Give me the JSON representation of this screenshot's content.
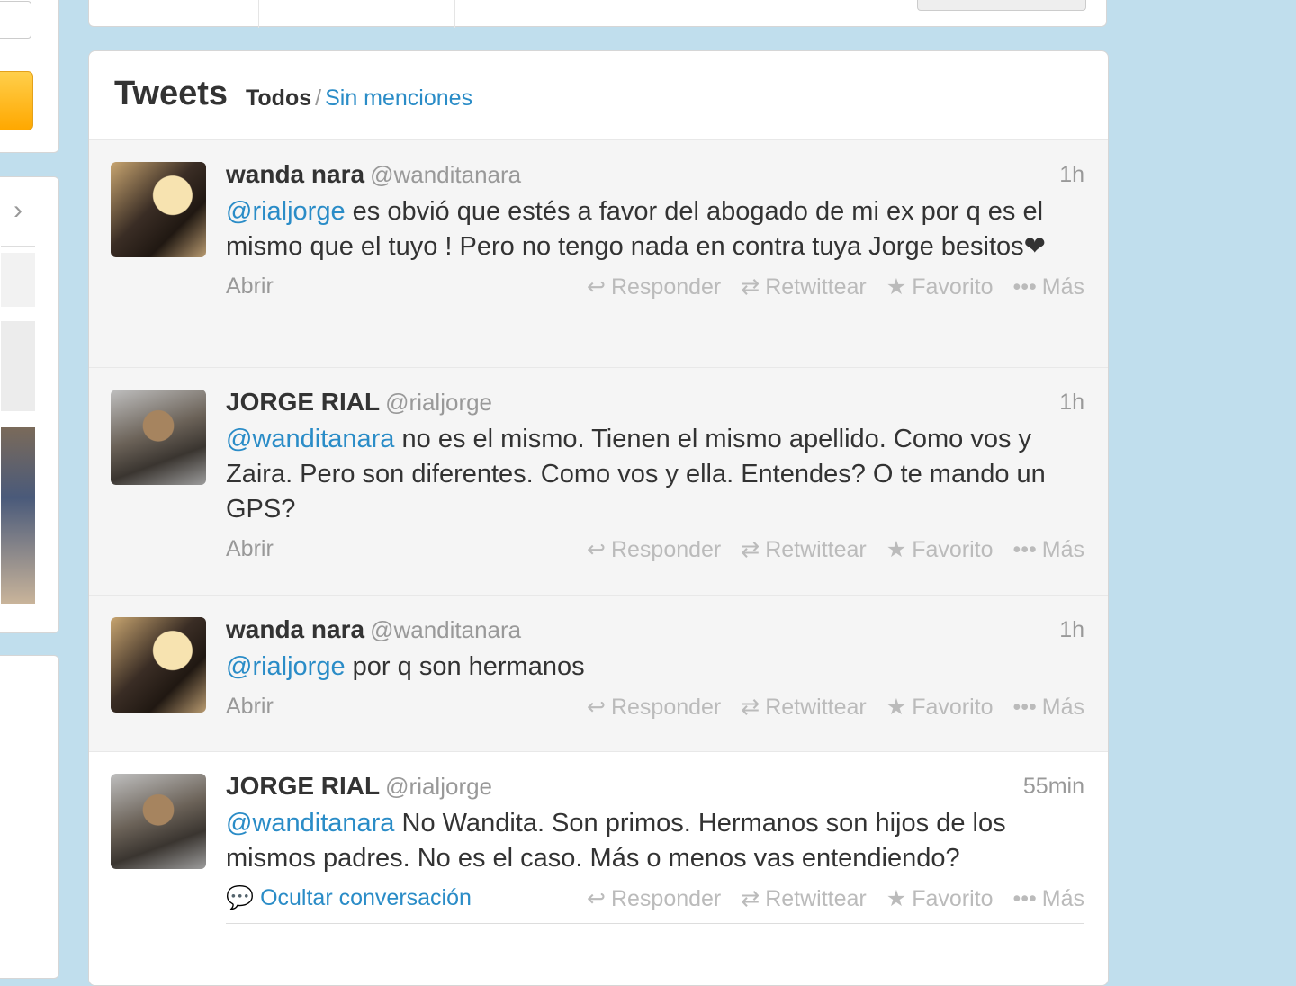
{
  "stream": {
    "title": "Tweets",
    "filter_active": "Todos",
    "filter_sep": "/",
    "filter_other": "Sin menciones"
  },
  "tweets": [
    {
      "name": "wanda nara",
      "handle": "@wanditanara",
      "time": "1h",
      "mention": "@rialjorge",
      "text": " es obvió que estés a favor del abogado de mi ex por q es el mismo que el tuyo ! Pero no tengo nada en contra tuya Jorge besitos❤",
      "expand": "Abrir"
    },
    {
      "name": "JORGE RIAL",
      "handle": "@rialjorge",
      "time": "1h",
      "mention": "@wanditanara",
      "text": " no es el mismo. Tienen el mismo apellido. Como vos y Zaira. Pero son diferentes. Como vos y ella. Entendes? O te mando un GPS?",
      "expand": "Abrir"
    },
    {
      "name": "wanda nara",
      "handle": "@wanditanara",
      "time": "1h",
      "mention": "@rialjorge",
      "text": " por q son hermanos",
      "expand": "Abrir"
    },
    {
      "name": "JORGE RIAL",
      "handle": "@rialjorge",
      "time": "55min",
      "mention": "@wanditanara",
      "text": " No Wandita. Son primos. Hermanos son hijos de los mismos padres. No es el caso. Más o menos vas entendiendo?",
      "expand": "Ocultar conversación"
    }
  ],
  "actions": {
    "reply": "Responder",
    "retweet": "Retwittear",
    "favorite": "Favorito",
    "more": "Más"
  },
  "icons": {
    "reply": "reply-arrow-icon",
    "retweet": "retweet-icon",
    "favorite": "star-icon",
    "more": "ellipsis-icon",
    "conversation": "speech-bubble-icon"
  },
  "colors": {
    "link": "#2a8cc7",
    "background": "#c0deed",
    "tweet_bg": "#f5f5f5"
  }
}
